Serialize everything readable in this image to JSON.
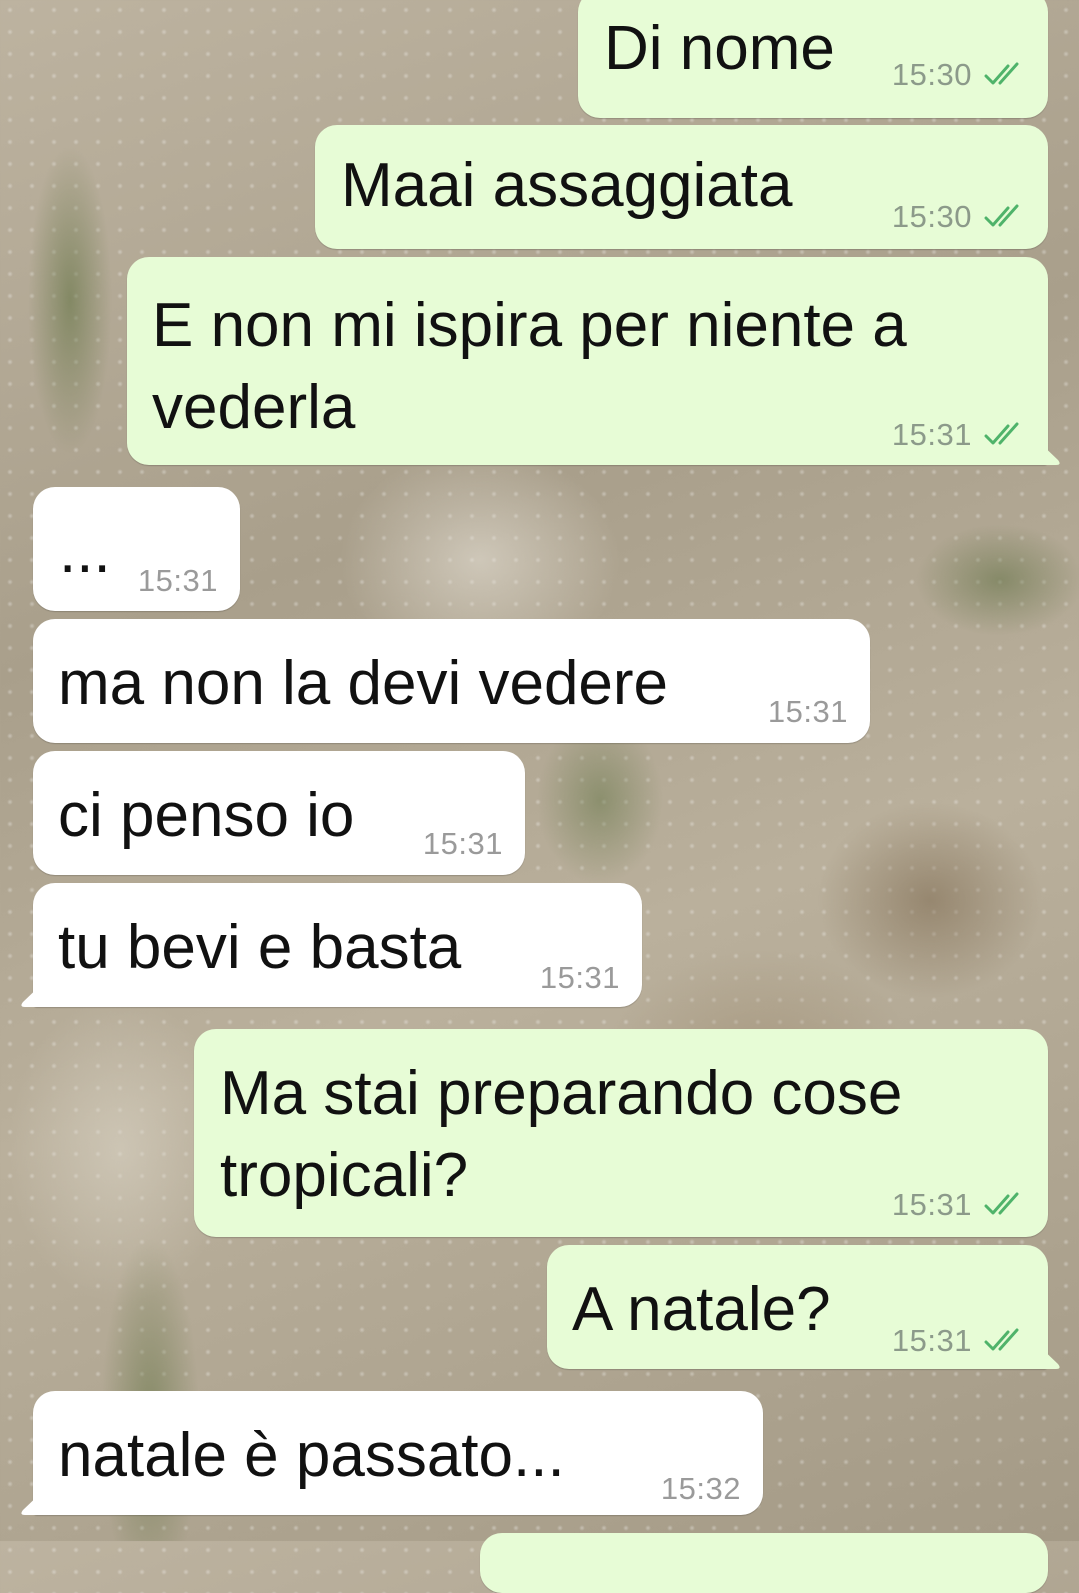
{
  "messages": [
    {
      "direction": "out",
      "text": "Di nome",
      "time": "15:30",
      "status": "read-double-tick"
    },
    {
      "direction": "out",
      "text": "Maai assaggiata",
      "time": "15:30",
      "status": "read-double-tick"
    },
    {
      "direction": "out",
      "text": "E non mi ispira per niente a\nvederla",
      "time": "15:31",
      "status": "read-double-tick"
    },
    {
      "direction": "in",
      "text": "...",
      "time": "15:31"
    },
    {
      "direction": "in",
      "text": "ma non la devi vedere",
      "time": "15:31"
    },
    {
      "direction": "in",
      "text": "ci penso io",
      "time": "15:31"
    },
    {
      "direction": "in",
      "text": "tu bevi e basta",
      "time": "15:31"
    },
    {
      "direction": "out",
      "text": "Ma stai preparando cose\ntropicali?",
      "time": "15:31",
      "status": "read-double-tick"
    },
    {
      "direction": "out",
      "text": "A natale?",
      "time": "15:31",
      "status": "read-double-tick"
    },
    {
      "direction": "in",
      "text": "natale è passato...",
      "time": "15:32"
    }
  ],
  "colors": {
    "outgoing_bubble": "#e7fcd6",
    "incoming_bubble": "#ffffff",
    "tick": "#4fb36a"
  },
  "icons": {
    "read_status": "double-check-icon"
  }
}
